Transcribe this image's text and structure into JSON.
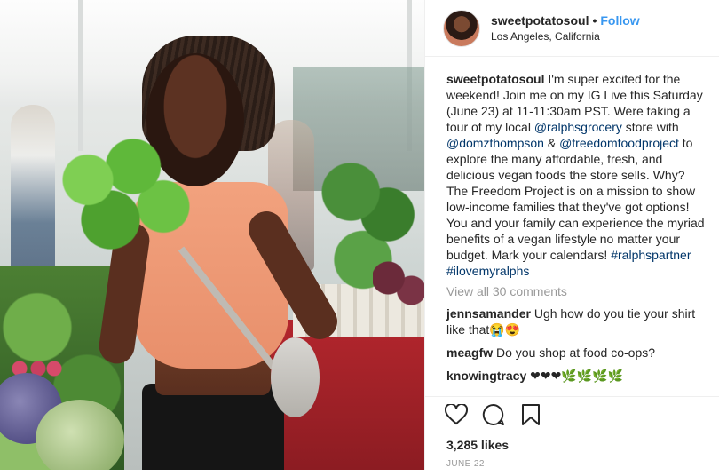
{
  "post": {
    "username": "sweetpotatosoul",
    "follow_label": "Follow",
    "separator": "•",
    "location": "Los Angeles, California",
    "caption_text": [
      {
        "t": "I'm super excited for the weekend! Join me on my IG Live this Saturday (June 23) at 11-11:30am PST. Were taking a tour of my local "
      },
      {
        "t": "@ralphsgrocery",
        "link": true
      },
      {
        "t": " store with "
      },
      {
        "t": "@domzthompson",
        "link": true
      },
      {
        "t": " & "
      },
      {
        "t": "@freedomfoodproject",
        "link": true
      },
      {
        "t": " to explore the many affordable, fresh, and delicious vegan foods the store sells. Why? The Freedom Project is on a mission to show low-income families that they've got options! You and your family can experience the myriad benefits of a vegan lifestyle no matter your budget. Mark your calendars! "
      },
      {
        "t": "#ralphspartner",
        "link": true
      },
      {
        "t": " "
      },
      {
        "t": "#ilovemyralphs",
        "link": true
      }
    ],
    "view_all_label": "View all 30 comments",
    "comments": [
      {
        "user": "jennsamander",
        "text": "Ugh how do you tie your shirt like that😭😍"
      },
      {
        "user": "meagfw",
        "text": "Do you shop at food co-ops?"
      },
      {
        "user": "knowingtracy",
        "text": "❤❤❤🌿🌿🌿🌿"
      }
    ],
    "likes": "3,285 likes",
    "date": "JUNE 22",
    "icons": {
      "like": "heart-icon",
      "comment": "comment-bubble-icon",
      "save": "bookmark-icon"
    },
    "colors": {
      "accent": "#3897f0",
      "link": "#003569",
      "muted": "#999999"
    }
  }
}
